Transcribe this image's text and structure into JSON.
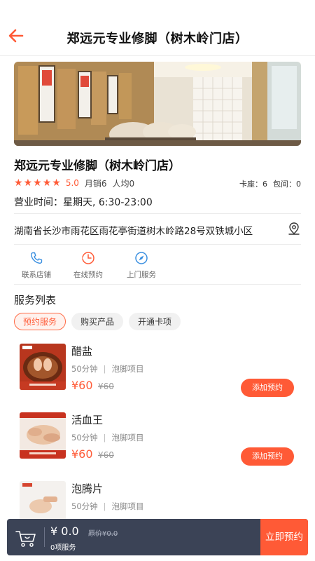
{
  "header": {
    "title": "郑远元专业修脚（树木岭门店）",
    "back_icon": "arrow-left-icon",
    "accent": "#ff5a36"
  },
  "shop": {
    "name": "郑远元专业修脚（树木岭门店）",
    "rating_stars": 5,
    "rating": "5.0",
    "monthly_sales": "月销6",
    "avg_price": "人均0",
    "card_seats": "卡座：6",
    "private_rooms": "包间：0",
    "hours": "营业时间：星期天, 6:30-23:00",
    "address": "湖南省长沙市雨花区雨花亭街道树木岭路28号双铁城小区"
  },
  "actions": [
    {
      "label": "联系店铺",
      "icon": "phone-icon"
    },
    {
      "label": "在线预约",
      "icon": "clock-icon"
    },
    {
      "label": "上门服务",
      "icon": "compass-icon"
    }
  ],
  "services_section": {
    "title": "服务列表",
    "tabs": [
      "预约服务",
      "购买产品",
      "开通卡项"
    ],
    "active_tab": 0
  },
  "services": [
    {
      "name": "醋盐",
      "duration": "50分钟",
      "category": "泡脚项目",
      "price": "¥60",
      "original_price": "¥60",
      "button": "添加预约"
    },
    {
      "name": "活血王",
      "duration": "50分钟",
      "category": "泡脚项目",
      "price": "¥60",
      "original_price": "¥60",
      "button": "添加预约"
    },
    {
      "name": "泡腾片",
      "duration": "50分钟",
      "category": "泡脚项目"
    }
  ],
  "cart": {
    "total": "¥ 0.0",
    "original": "原价¥0.0",
    "count": "0项服务",
    "book_label": "立即预约",
    "bar_color": "#3b4356"
  }
}
